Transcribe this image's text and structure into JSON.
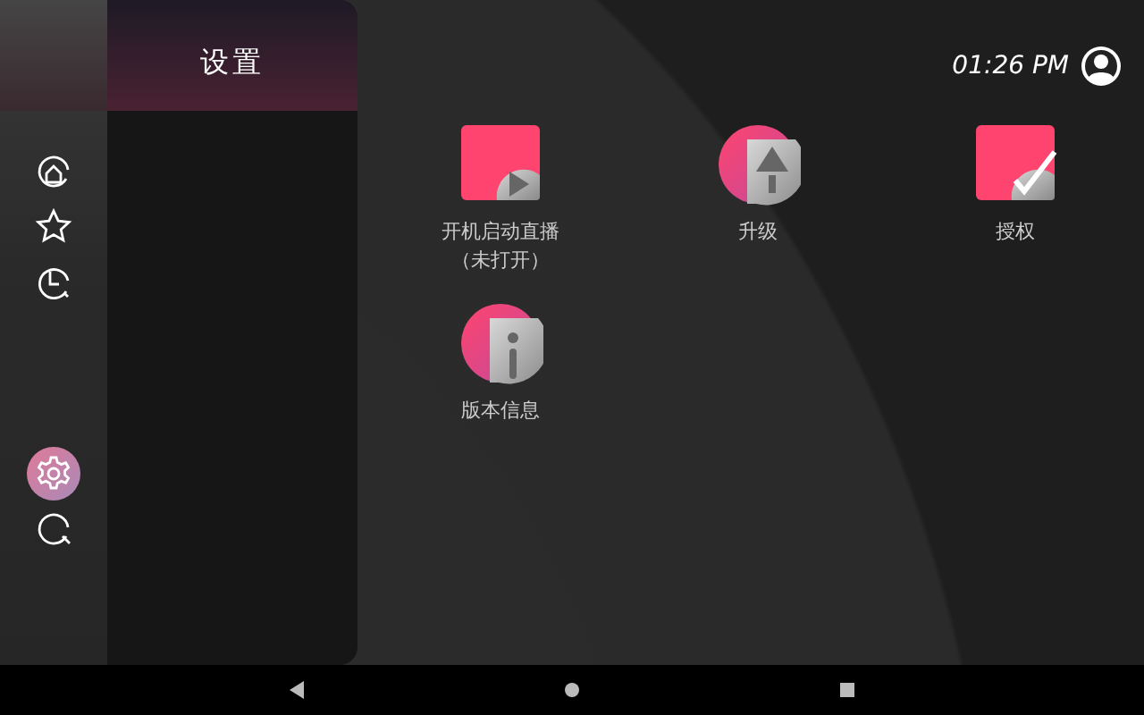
{
  "sidebar": {
    "items": [
      {
        "kind": "home",
        "selected": false
      },
      {
        "kind": "star",
        "selected": false
      },
      {
        "kind": "history",
        "selected": false
      },
      {
        "kind": "settings",
        "selected": true
      },
      {
        "kind": "search",
        "selected": false
      }
    ]
  },
  "panel": {
    "title": "设置"
  },
  "status": {
    "time": "01:26 PM"
  },
  "tiles": [
    {
      "kind": "play",
      "label": "开机启动直播",
      "note": "（未打开）"
    },
    {
      "kind": "upgrade",
      "label": "升级"
    },
    {
      "kind": "check",
      "label": "授权"
    },
    {
      "kind": "info",
      "label": "版本信息"
    }
  ],
  "nav_bar": {
    "buttons": [
      {
        "kind": "back"
      },
      {
        "kind": "home"
      },
      {
        "kind": "recents"
      }
    ]
  }
}
